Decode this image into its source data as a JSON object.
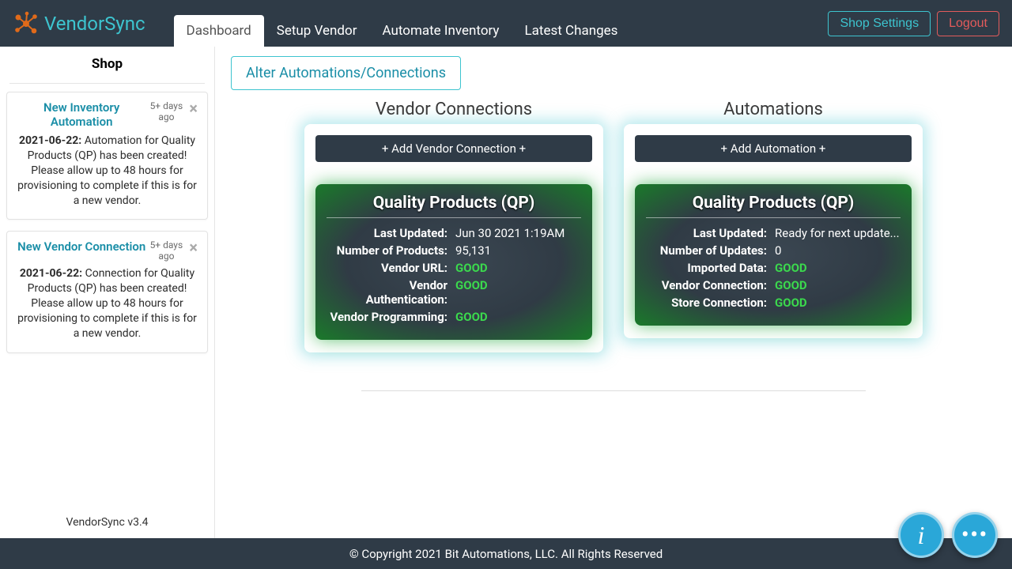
{
  "brand": "VendorSync",
  "nav": {
    "items": [
      {
        "label": "Dashboard",
        "active": true
      },
      {
        "label": "Setup Vendor"
      },
      {
        "label": "Automate Inventory"
      },
      {
        "label": "Latest Changes"
      }
    ],
    "settings": "Shop Settings",
    "logout": "Logout"
  },
  "sidebar": {
    "title": "Shop",
    "version": "VendorSync v3.4",
    "notes": [
      {
        "title": "New Inventory Automation",
        "time": "5+ days ago",
        "date": "2021-06-22:",
        "body": "Automation for Quality Products (QP) has been created! Please allow up to 48 hours for provisioning to complete if this is for a new vendor."
      },
      {
        "title": "New Vendor Connection",
        "time": "5+ days ago",
        "date": "2021-06-22:",
        "body": "Connection for Quality Products (QP) has been created! Please allow up to 48 hours for provisioning to complete if this is for a new vendor."
      }
    ]
  },
  "main": {
    "alter_btn": "Alter Automations/Connections",
    "vendor": {
      "title": "Vendor Connections",
      "add": "+ Add Vendor Connection +",
      "card_title": "Quality Products (QP)",
      "rows": [
        {
          "k": "Last Updated:",
          "v": "Jun 30 2021 1:19AM"
        },
        {
          "k": "Number of Products:",
          "v": "95,131"
        },
        {
          "k": "Vendor URL:",
          "v": "GOOD",
          "good": true
        },
        {
          "k": "Vendor Authentication:",
          "v": "GOOD",
          "good": true
        },
        {
          "k": "Vendor Programming:",
          "v": "GOOD",
          "good": true
        }
      ]
    },
    "auto": {
      "title": "Automations",
      "add": "+ Add Automation +",
      "card_title": "Quality Products (QP)",
      "rows": [
        {
          "k": "Last Updated:",
          "v": "Ready for next update..."
        },
        {
          "k": "Number of Updates:",
          "v": "0"
        },
        {
          "k": "Imported Data:",
          "v": "GOOD",
          "good": true
        },
        {
          "k": "Vendor Connection:",
          "v": "GOOD",
          "good": true
        },
        {
          "k": "Store Connection:",
          "v": "GOOD",
          "good": true
        }
      ]
    }
  },
  "footer": "© Copyright 2021 Bit Automations, LLC. All Rights Reserved"
}
